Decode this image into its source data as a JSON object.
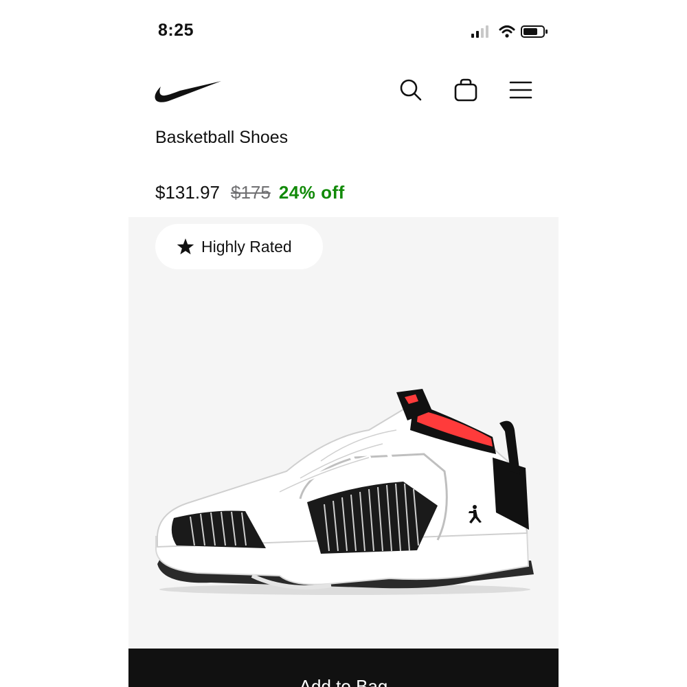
{
  "status_bar": {
    "time": "8:25",
    "icons": [
      "signal-icon",
      "wifi-icon",
      "battery-icon"
    ]
  },
  "header": {
    "logo": "nike-swoosh-logo",
    "icons": [
      "search-icon",
      "bag-icon",
      "menu-icon"
    ]
  },
  "product": {
    "category": "Basketball Shoes",
    "price_current": "$131.97",
    "price_original": "$175",
    "discount": "24% off",
    "badge_label": "Highly Rated",
    "badge_icon": "star-icon"
  },
  "cta": {
    "label": "Add to Bag"
  },
  "colors": {
    "discount_green": "#128a09",
    "media_background": "#f5f5f5",
    "button_background": "#111111",
    "accent_red": "#ff3b3b"
  }
}
